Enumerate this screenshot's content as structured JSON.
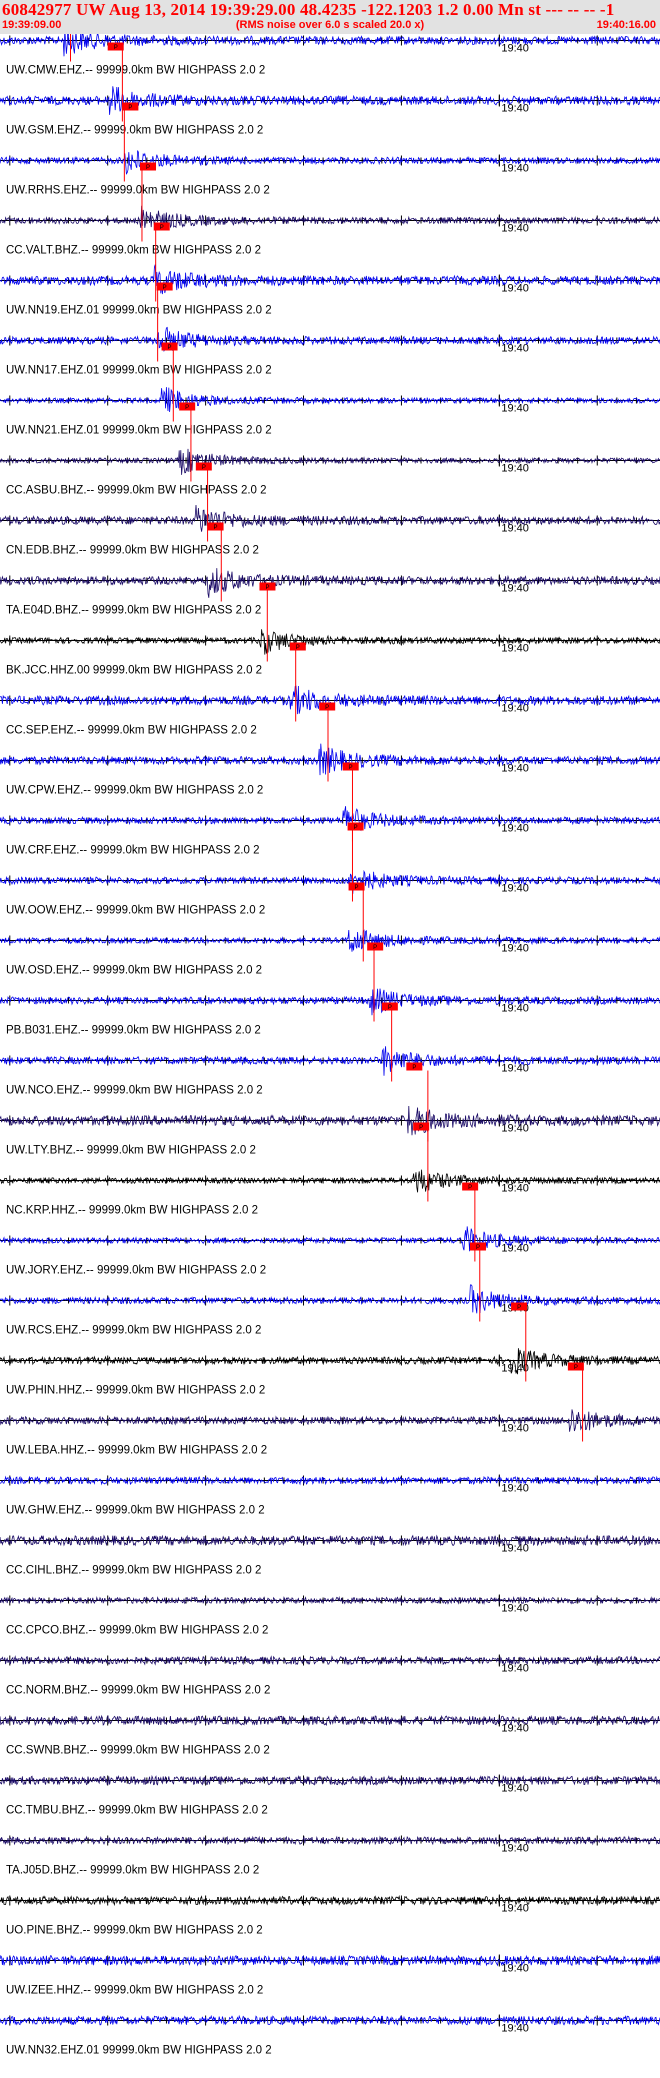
{
  "header": {
    "title": "60842977 UW Aug 13, 2014 19:39:29.00   48.4235 -122.1203  1.2 0.00 Mn st --- -- --   -1",
    "start_time": "19:39:09.00",
    "subtitle": "(RMS noise over 6.0 s scaled 20.0 x)",
    "end_time": "19:40:16.00"
  },
  "colors": {
    "header_bg": "#e2e2e2",
    "header_text": "#ff0000",
    "pick": "#ff0000",
    "axis": "#000000"
  },
  "chart_data": {
    "type": "seismogram-record-section",
    "time_start": "19:39:09.00",
    "time_end": "19:40:16.00",
    "duration_s": 67,
    "tick_label": "19:40",
    "tick_label_time_s": 51,
    "pick_marker_label": "P",
    "traces": [
      {
        "label": "UW.CMW.EHZ.-- 99999.0km BW  HIGHPASS  2.0  2",
        "color": "#0000ee",
        "pick_s": 6.4,
        "pick_end_s": 7.2
      },
      {
        "label": "UW.GSM.EHZ.-- 99999.0km BW  HIGHPASS  2.0  2",
        "color": "#0000ee",
        "pick_s": 11.0,
        "pick_end_s": 12.5
      },
      {
        "label": "UW.RRHS.EHZ.-- 99999.0km BW  HIGHPASS  2.0  2",
        "color": "#0000ee",
        "pick_s": 12.5,
        "pick_end_s": 12.7
      },
      {
        "label": "CC.VALT.BHZ.-- 99999.0km BW  HIGHPASS  2.0  2",
        "color": "#1a0a66",
        "pick_s": 14.3,
        "pick_end_s": 14.5
      },
      {
        "label": "UW.NN19.EHZ.01 99999.0km BW  HIGHPASS  2.0  2",
        "color": "#0000ee",
        "pick_s": 15.7,
        "pick_end_s": 15.9
      },
      {
        "label": "UW.NN17.EHZ.01 99999.0km BW  HIGHPASS  2.0  2",
        "color": "#0000ee",
        "pick_s": 16.0,
        "pick_end_s": 16.1
      },
      {
        "label": "UW.NN21.EHZ.01 99999.0km BW  HIGHPASS  2.0  2",
        "color": "#0000ee",
        "pick_s": 16.5,
        "pick_end_s": 17.7
      },
      {
        "label": "CC.ASBU.BHZ.-- 99999.0km BW  HIGHPASS  2.0  2",
        "color": "#1a0a66",
        "pick_s": 18.3,
        "pick_end_s": 19.5
      },
      {
        "label": "CN.EDB.BHZ.-- 99999.0km BW  HIGHPASS  2.0  2",
        "color": "#1a0a66",
        "pick_s": 20.0,
        "pick_end_s": 21.2
      },
      {
        "label": "TA.E04D.BHZ.-- 99999.0km BW  HIGHPASS  2.0  2",
        "color": "#1a0a66",
        "pick_s": 21.2,
        "pick_end_s": 22.6
      },
      {
        "label": "BK.JCC.HHZ.00 99999.0km BW  HIGHPASS  2.0  2",
        "color": "#000000",
        "pick_s": 26.5,
        "pick_end_s": 27.3
      },
      {
        "label": "CC.SEP.EHZ.-- 99999.0km BW  HIGHPASS  2.0  2",
        "color": "#0000ee",
        "pick_s": 29.6,
        "pick_end_s": 30.2
      },
      {
        "label": "UW.CPW.EHZ.-- 99999.0km BW  HIGHPASS  2.0  2",
        "color": "#0000ee",
        "pick_s": 32.6,
        "pick_end_s": 33.5
      },
      {
        "label": "UW.CRF.EHZ.-- 99999.0km BW  HIGHPASS  2.0  2",
        "color": "#0000ee",
        "pick_s": 35.0,
        "pick_end_s": 36.0
      },
      {
        "label": "UW.OOW.EHZ.-- 99999.0km BW  HIGHPASS  2.0  2",
        "color": "#0000ee",
        "pick_s": 35.5,
        "pick_end_s": 36.0
      },
      {
        "label": "UW.OSD.EHZ.-- 99999.0km BW  HIGHPASS  2.0  2",
        "color": "#0000ee",
        "pick_s": 35.6,
        "pick_end_s": 37.1
      },
      {
        "label": "PB.B031.EHZ.-- 99999.0km BW  HIGHPASS  2.0  2",
        "color": "#0000ee",
        "pick_s": 37.5,
        "pick_end_s": 38.2
      },
      {
        "label": "UW.NCO.EHZ.-- 99999.0km BW  HIGHPASS  2.0  2",
        "color": "#0000ee",
        "pick_s": 39.0,
        "pick_end_s": 40.0
      },
      {
        "label": "UW.LTY.BHZ.-- 99999.0km BW  HIGHPASS  2.0  2",
        "color": "#1a0a66",
        "pick_s": 41.5,
        "pick_end_s": 43.7
      },
      {
        "label": "NC.KRP.HHZ.-- 99999.0km BW  HIGHPASS  2.0  2",
        "color": "#000000",
        "pick_s": 42.2,
        "pick_end_s": 43.7
      },
      {
        "label": "UW.JORY.EHZ.-- 99999.0km BW  HIGHPASS  2.0  2",
        "color": "#0000ee",
        "pick_s": 47.2,
        "pick_end_s": 48.5
      },
      {
        "label": "UW.RCS.EHZ.-- 99999.0km BW  HIGHPASS  2.0  2",
        "color": "#0000ee",
        "pick_s": 48.0,
        "pick_end_s": 49.0
      },
      {
        "label": "UW.PHIN.HHZ.-- 99999.0km BW  HIGHPASS  2.0  2",
        "color": "#000000",
        "pick_s": 52.2,
        "pick_end_s": 53.7
      },
      {
        "label": "UW.LEBA.HHZ.-- 99999.0km BW  HIGHPASS  2.0  2",
        "color": "#1a0a66",
        "pick_s": 58.0,
        "pick_end_s": 59.5
      },
      {
        "label": "UW.GHW.EHZ.-- 99999.0km BW  HIGHPASS  2.0  2",
        "color": "#0000ee",
        "pick_s": null,
        "pick_end_s": null
      },
      {
        "label": "CC.CIHL.BHZ.-- 99999.0km BW  HIGHPASS  2.0  2",
        "color": "#1a0a66",
        "pick_s": null,
        "pick_end_s": null
      },
      {
        "label": "CC.CPCO.BHZ.-- 99999.0km BW  HIGHPASS  2.0  2",
        "color": "#1a0a66",
        "pick_s": null,
        "pick_end_s": null
      },
      {
        "label": "CC.NORM.BHZ.-- 99999.0km BW  HIGHPASS  2.0  2",
        "color": "#1a0a66",
        "pick_s": null,
        "pick_end_s": null
      },
      {
        "label": "CC.SWNB.BHZ.-- 99999.0km BW  HIGHPASS  2.0  2",
        "color": "#1a0a66",
        "pick_s": null,
        "pick_end_s": null
      },
      {
        "label": "CC.TMBU.BHZ.-- 99999.0km BW  HIGHPASS  2.0  2",
        "color": "#1a0a66",
        "pick_s": null,
        "pick_end_s": null
      },
      {
        "label": "TA.J05D.BHZ.-- 99999.0km BW  HIGHPASS  2.0  2",
        "color": "#1a0a66",
        "pick_s": null,
        "pick_end_s": null
      },
      {
        "label": "UO.PINE.BHZ.-- 99999.0km BW  HIGHPASS  2.0  2",
        "color": "#000000",
        "pick_s": null,
        "pick_end_s": null
      },
      {
        "label": "UW.IZEE.HHZ.-- 99999.0km BW  HIGHPASS  2.0  2",
        "color": "#0000ee",
        "pick_s": null,
        "pick_end_s": null
      },
      {
        "label": "UW.NN32.EHZ.01 99999.0km BW  HIGHPASS  2.0  2",
        "color": "#0000ee",
        "pick_s": null,
        "pick_end_s": null
      }
    ]
  }
}
